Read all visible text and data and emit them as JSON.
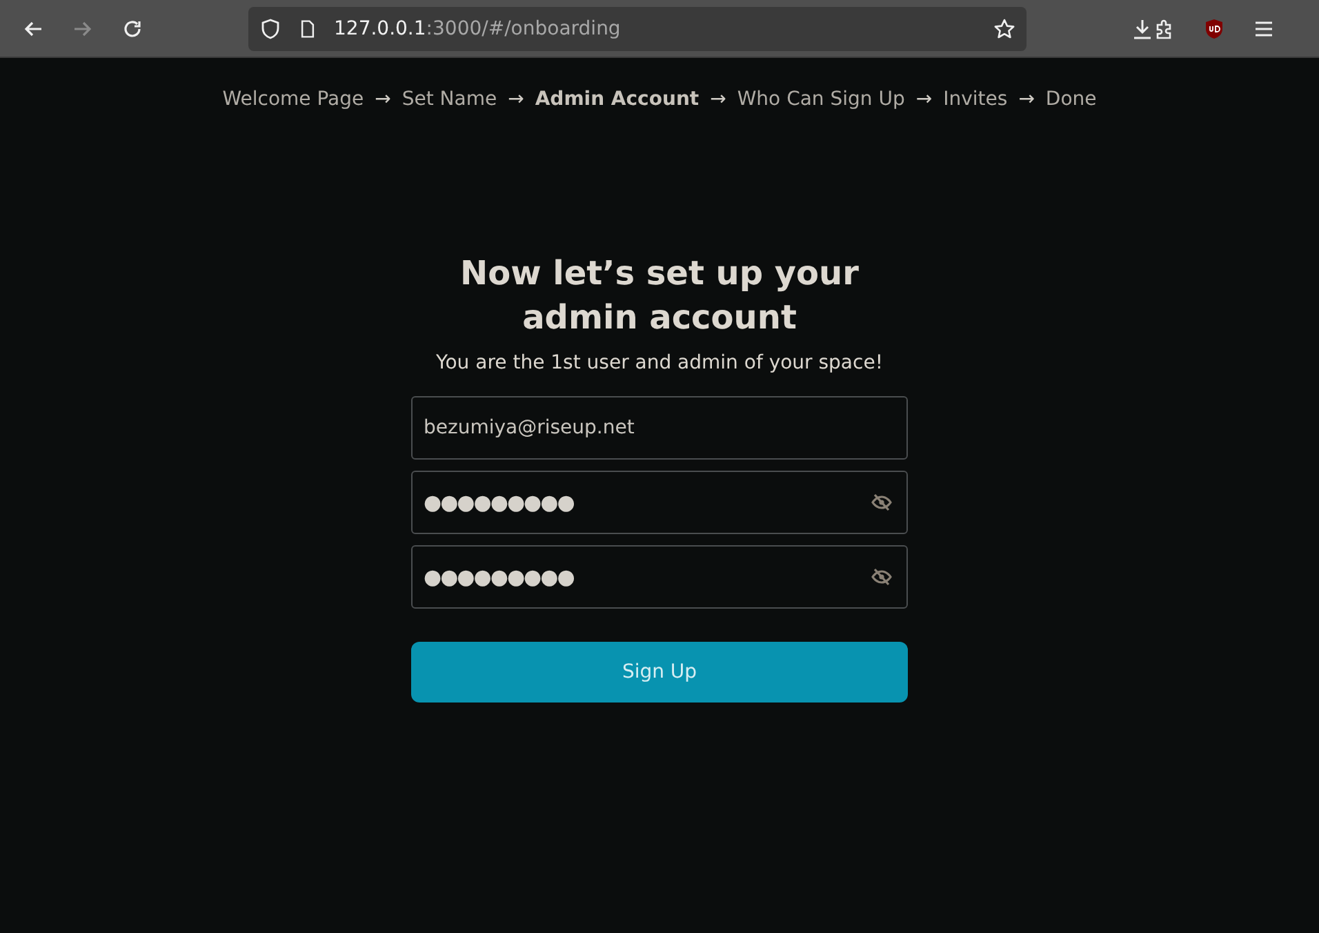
{
  "browser": {
    "url_host": "127.0.0.1",
    "url_rest": ":3000/#/onboarding",
    "forward_disabled": true
  },
  "steps": [
    {
      "label": "Welcome Page",
      "selected": false,
      "arrow": "→"
    },
    {
      "label": "Set Name",
      "selected": false,
      "arrow": "→"
    },
    {
      "label": "Admin Account",
      "selected": true,
      "arrow": "→"
    },
    {
      "label": "Who Can Sign Up",
      "selected": false,
      "arrow": "→"
    },
    {
      "label": "Invites",
      "selected": false,
      "arrow": "→"
    },
    {
      "label": "Done",
      "selected": false
    }
  ],
  "title_lines": [
    "Now let’s set up your",
    "admin account"
  ],
  "subtitle": "You are the 1st user and admin of your space!",
  "fields": [
    {
      "kind": "text",
      "value": "bezumiya@riseup.net"
    },
    {
      "kind": "password",
      "value": "●●●●●●●●●"
    },
    {
      "kind": "password",
      "value": "●●●●●●●●●"
    }
  ],
  "submit": "Sign Up"
}
